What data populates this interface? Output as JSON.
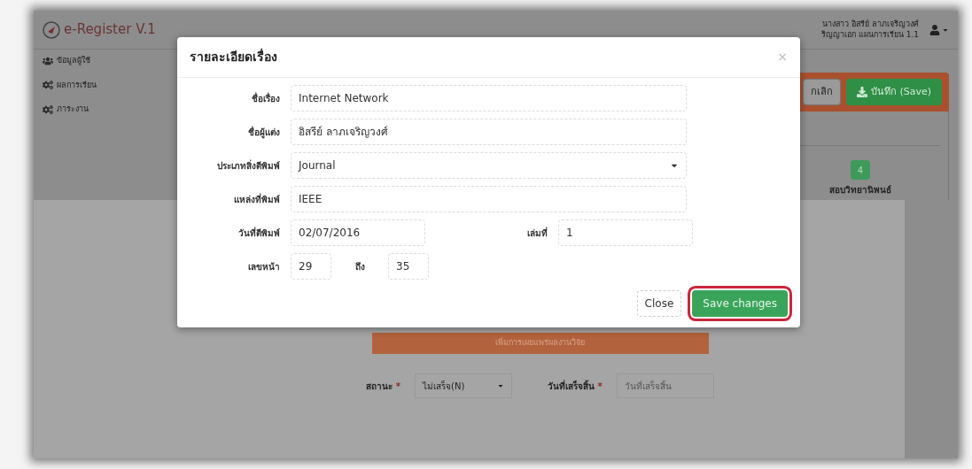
{
  "app": {
    "logo_text": "e-Register V.1",
    "user_name": "นางสาว อิสรีย์ ลาภเจริญวงศ์",
    "user_program": "ริญญาเอก แผนการเรียน 1.1"
  },
  "sidebar": {
    "items": [
      {
        "label": "ข้อมูลผู้ใช้",
        "kind": "users"
      },
      {
        "label": "ผลการเรียน",
        "kind": "cogs"
      },
      {
        "label": "ภาระงาน",
        "kind": "cogs"
      }
    ]
  },
  "toolbar": {
    "buttons": [
      {
        "label": "กเลิก",
        "kind": "cancel"
      },
      {
        "label": "บันทึก (Save)",
        "kind": "save"
      }
    ]
  },
  "step": {
    "number": "4",
    "label": "สอบวิทยานิพนธ์"
  },
  "background_form": {
    "banner": "เพิ่มการเผยแพร่ผลงานวิจัย",
    "status_label": "สถานะ",
    "status_required": "*",
    "status_value": "ไม่เสร็จ(N)",
    "date_label": "วันที่เสร็จสิ้น",
    "date_required": "*",
    "date_placeholder": "วันที่เสร็จสิ้น"
  },
  "modal": {
    "title": "รายละเอียดเรื่อง",
    "close_glyph": "×",
    "fields": [
      {
        "label": "ชื่อเรื่อง",
        "value": "Internet Network",
        "kind": "text"
      },
      {
        "label": "ชื่อผู้แต่ง",
        "value": "อิสรีย์ ลาภเจริญวงศ์",
        "kind": "text"
      },
      {
        "label": "ประเภทสิ่งตีพิมพ์",
        "value": "Journal",
        "kind": "select"
      },
      {
        "label": "แหล่งที่พิมพ์",
        "value": "IEEE",
        "kind": "text"
      }
    ],
    "date": {
      "label": "วันที่ตีพิมพ์",
      "value": "02/07/2016"
    },
    "volume": {
      "label": "เล่มที่",
      "value": "1"
    },
    "pages": {
      "label": "เลขหน้า",
      "from": "29",
      "to_label": "ถึง",
      "to": "35"
    },
    "buttons": [
      {
        "label": "Close",
        "kind": "default",
        "highlighted": false
      },
      {
        "label": "Save changes",
        "kind": "primary",
        "highlighted": true
      }
    ]
  }
}
